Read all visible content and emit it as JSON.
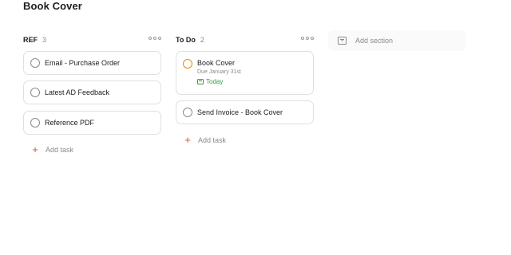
{
  "page": {
    "title": "Book Cover"
  },
  "columns": [
    {
      "name": "REF",
      "count": "3",
      "tasks": [
        {
          "label": "Email - Purchase Order"
        },
        {
          "label": "Latest AD Feedback"
        },
        {
          "label": "Reference PDF"
        }
      ],
      "add_task_label": "Add task"
    },
    {
      "name": "To Do",
      "count": "2",
      "tasks": [
        {
          "label": "Book Cover",
          "description": "Due January 31st",
          "due_date": "Today",
          "priority_color": "#eb8909",
          "date_color": "#2f9c4a"
        },
        {
          "label": "Send Invoice - Book Cover"
        }
      ],
      "add_task_label": "Add task"
    }
  ],
  "add_section": {
    "label": "Add section"
  },
  "icons": {
    "more": "more-horizontal-icon",
    "add": "plus-icon",
    "calendar": "calendar-icon",
    "section": "add-section-icon"
  },
  "colors": {
    "accent": "#dc4c3e",
    "today": "#2f9c4a",
    "priority": "#eb8909"
  }
}
